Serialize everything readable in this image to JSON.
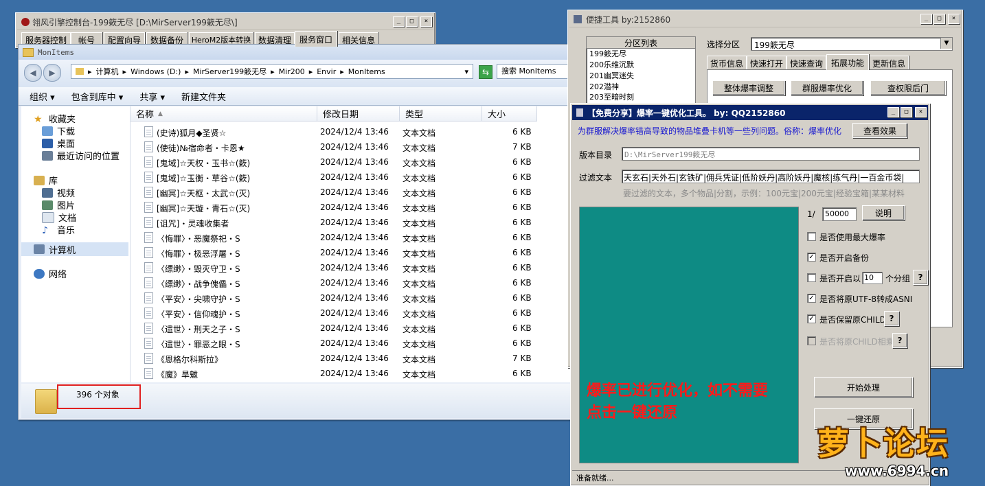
{
  "console": {
    "title": "翎风引擎控制台-199簌无尽 [D:\\MirServer199簌无尽\\]",
    "tabs": [
      "服务器控制",
      "帐号",
      "配置向导",
      "数据备份",
      "HeroM2版本转换",
      "数据清理",
      "服务窗口",
      "相关信息"
    ]
  },
  "explorer": {
    "title": "MonItems",
    "breadcrumb": [
      "计算机",
      "Windows (D:)",
      "MirServer199簌无尽",
      "Mir200",
      "Envir",
      "MonItems"
    ],
    "search_placeholder": "搜索 MonItems",
    "commands": [
      "组织 ▾",
      "包含到库中 ▾",
      "共享 ▾",
      "新建文件夹"
    ],
    "nav": {
      "favorites": "收藏夹",
      "fav_items": [
        "下载",
        "桌面",
        "最近访问的位置"
      ],
      "library": "库",
      "lib_items": [
        "视频",
        "图片",
        "文档",
        "音乐"
      ],
      "computer": "计算机",
      "network": "网络"
    },
    "columns": [
      "名称",
      "修改日期",
      "类型",
      "大小"
    ],
    "files": [
      {
        "name": "(史诗)狐月◆圣贤☆",
        "date": "2024/12/4 13:46",
        "type": "文本文档",
        "size": "6 KB"
      },
      {
        "name": "(使徒)№宿命者・卡恩★",
        "date": "2024/12/4 13:46",
        "type": "文本文档",
        "size": "7 KB"
      },
      {
        "name": "[鬼域]☆天权・玉书☆(簌)",
        "date": "2024/12/4 13:46",
        "type": "文本文档",
        "size": "6 KB"
      },
      {
        "name": "[鬼域]☆玉衡・草谷☆(簌)",
        "date": "2024/12/4 13:46",
        "type": "文本文档",
        "size": "6 KB"
      },
      {
        "name": "[幽冥]☆天枢・太武☆(灭)",
        "date": "2024/12/4 13:46",
        "type": "文本文档",
        "size": "6 KB"
      },
      {
        "name": "[幽冥]☆天璇・青石☆(灭)",
        "date": "2024/12/4 13:46",
        "type": "文本文档",
        "size": "6 KB"
      },
      {
        "name": "[诅咒]・灵魂收集者",
        "date": "2024/12/4 13:46",
        "type": "文本文档",
        "size": "6 KB"
      },
      {
        "name": "〈悔罪〉・恶魔祭祀・S",
        "date": "2024/12/4 13:46",
        "type": "文本文档",
        "size": "6 KB"
      },
      {
        "name": "〈悔罪〉・极恶浮屠・S",
        "date": "2024/12/4 13:46",
        "type": "文本文档",
        "size": "6 KB"
      },
      {
        "name": "〈缥缈〉・毁灭守卫・S",
        "date": "2024/12/4 13:46",
        "type": "文本文档",
        "size": "6 KB"
      },
      {
        "name": "〈缥缈〉・战争傀儡・S",
        "date": "2024/12/4 13:46",
        "type": "文本文档",
        "size": "6 KB"
      },
      {
        "name": "〈平安〉・尖啸守护・S",
        "date": "2024/12/4 13:46",
        "type": "文本文档",
        "size": "6 KB"
      },
      {
        "name": "〈平安〉・信仰魂护・S",
        "date": "2024/12/4 13:46",
        "type": "文本文档",
        "size": "6 KB"
      },
      {
        "name": "〈遗世〉・刑天之子・S",
        "date": "2024/12/4 13:46",
        "type": "文本文档",
        "size": "6 KB"
      },
      {
        "name": "〈遗世〉・罪恶之眼・S",
        "date": "2024/12/4 13:46",
        "type": "文本文档",
        "size": "6 KB"
      },
      {
        "name": "《恩格尔科斯拉》",
        "date": "2024/12/4 13:46",
        "type": "文本文档",
        "size": "7 KB"
      },
      {
        "name": "《魔》旱魃",
        "date": "2024/12/4 13:46",
        "type": "文本文档",
        "size": "6 KB"
      }
    ],
    "status": "396 个对象"
  },
  "quick": {
    "title": "便捷工具  by:2152860",
    "partition_header": "分区列表",
    "partitions": [
      "199簌无尽",
      "200乐维沉默",
      "201幽冥迷失",
      "202潜神",
      "203至暗时刻"
    ],
    "select_label": "选择分区",
    "select_value": "199簌无尽",
    "tabs": [
      "货币信息",
      "快速打开",
      "快速查询",
      "拓展功能",
      "更新信息"
    ],
    "buttons": [
      "整体爆率调整",
      "群服爆率优化",
      "查权限后门"
    ]
  },
  "tool": {
    "title": "【免费分享】爆率一键优化工具。   by: QQ2152860",
    "desc": "为群服解决爆率错高导致的物品堆叠卡机等一些列问题。俗称：爆率优化",
    "view_effect": "查看效果",
    "dir_label": "版本目录",
    "dir_value": "D:\\MirServer199簌无尽",
    "filter_label": "过滤文本",
    "filter_value": "天玄石|天外石|玄铁矿|佣兵凭证|低阶妖丹|高阶妖丹|魔核|练气丹|一百金币袋|",
    "filter_hint": "要过滤的文本，多个物品|分割，示例：100元宝|200元宝|经验宝箱|某某材料",
    "ratio_prefix": "1/",
    "ratio_value": "50000",
    "explain": "说明",
    "options": [
      {
        "label": "是否使用最大爆率",
        "checked": false,
        "enabled": true
      },
      {
        "label": "是否开启备份",
        "checked": true,
        "enabled": true
      },
      {
        "label": "是否开启以",
        "checked": false,
        "enabled": true
      },
      {
        "label": "是否将原UTF-8转成ASNI",
        "checked": true,
        "enabled": true
      },
      {
        "label": "是否保留原CHILD",
        "checked": true,
        "enabled": true
      },
      {
        "label": "是否将原CHILD相乘",
        "checked": false,
        "enabled": false
      }
    ],
    "group_value": "10",
    "group_suffix": "个分组",
    "q": "?",
    "overlay_line1": "爆率已进行优化，如不需要",
    "overlay_line2": "点击一键还原",
    "start": "开始处理",
    "restore": "一键还原",
    "status": "准备就绪...",
    "preview_color": "#0e8b84",
    "overlay_color": "#ff1a1a"
  },
  "watermark": {
    "brand": "萝卜论坛",
    "url": "www.6994.cn"
  }
}
